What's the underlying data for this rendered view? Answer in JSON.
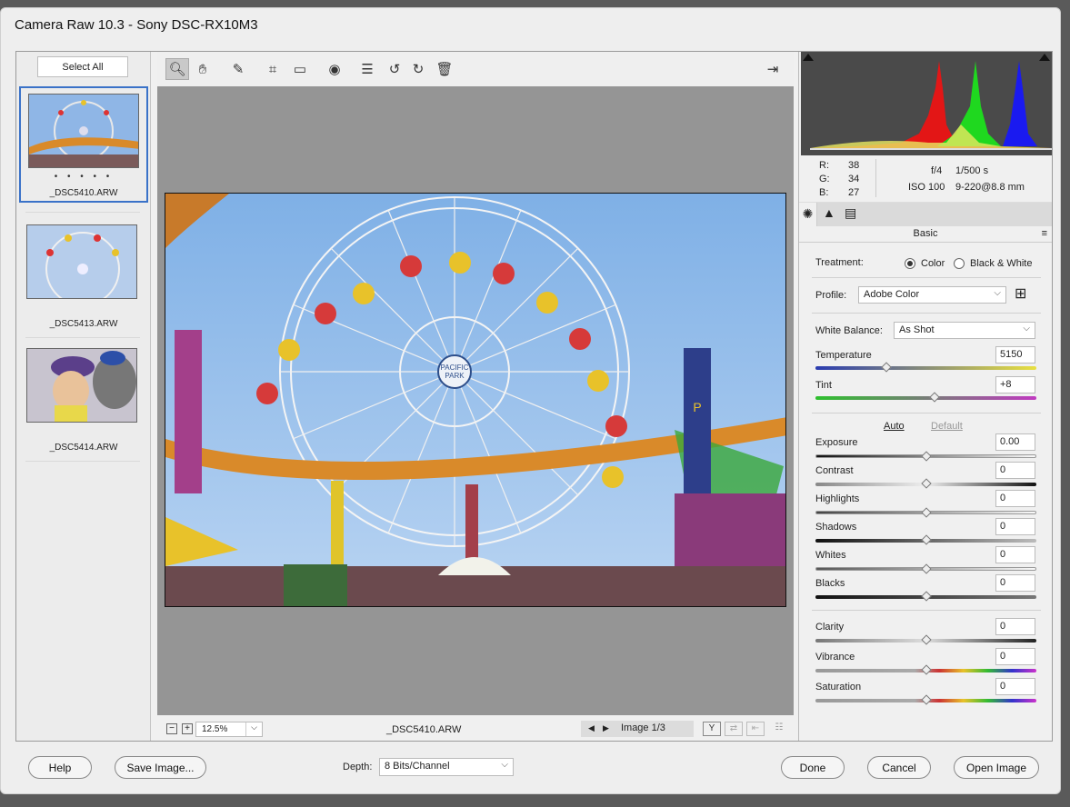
{
  "window": {
    "title": "Camera Raw 10.3  -  Sony DSC-RX10M3"
  },
  "filmstrip": {
    "select_all": "Select All",
    "items": [
      {
        "name": "_DSC5410.ARW",
        "rating": "• • • • •"
      },
      {
        "name": "_DSC5413.ARW"
      },
      {
        "name": "_DSC5414.ARW"
      }
    ]
  },
  "toolbar": {
    "icons": [
      "zoom-icon",
      "hand-icon",
      "eyedropper-icon",
      "crop-icon",
      "straighten-icon",
      "redeye-icon",
      "presets-icon",
      "rotate-left-icon",
      "rotate-right-icon",
      "trash-icon",
      "toggle-fullscreen-icon"
    ]
  },
  "status": {
    "zoom_minus": "−",
    "zoom_plus": "+",
    "zoom": "12.5%",
    "filename": "_DSC5410.ARW",
    "image_nav": "Image 1/3",
    "prev": "◀",
    "next": "▶"
  },
  "readout": {
    "r_label": "R:",
    "r": "38",
    "g_label": "G:",
    "g": "34",
    "b_label": "B:",
    "b": "27",
    "aperture": "f/4",
    "shutter": "1/500 s",
    "iso": "ISO 100",
    "lens": "9-220@8.8 mm"
  },
  "basic": {
    "title": "Basic",
    "treatment_label": "Treatment:",
    "color": "Color",
    "bw": "Black & White",
    "profile_label": "Profile:",
    "profile": "Adobe Color",
    "wb_label": "White Balance:",
    "wb": "As Shot",
    "temperature_label": "Temperature",
    "temperature": "5150",
    "temperature_pos": 0.32,
    "tint_label": "Tint",
    "tint": "+8",
    "tint_pos": 0.54,
    "auto": "Auto",
    "default": "Default",
    "exposure_label": "Exposure",
    "exposure": "0.00",
    "contrast_label": "Contrast",
    "contrast": "0",
    "highlights_label": "Highlights",
    "highlights": "0",
    "shadows_label": "Shadows",
    "shadows": "0",
    "whites_label": "Whites",
    "whites": "0",
    "blacks_label": "Blacks",
    "blacks": "0",
    "clarity_label": "Clarity",
    "clarity": "0",
    "vibrance_label": "Vibrance",
    "vibrance": "0",
    "saturation_label": "Saturation",
    "saturation": "0"
  },
  "bottom": {
    "help": "Help",
    "save": "Save Image...",
    "depth_label": "Depth:",
    "depth": "8 Bits/Channel",
    "done": "Done",
    "cancel": "Cancel",
    "open": "Open Image"
  }
}
